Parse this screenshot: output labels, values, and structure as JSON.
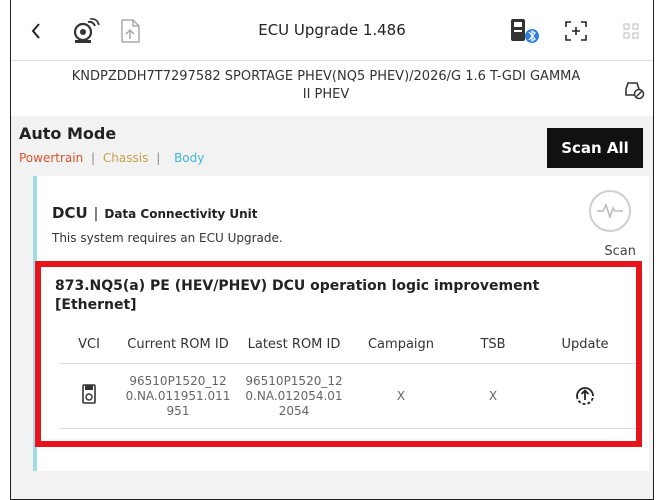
{
  "header": {
    "title": "ECU Upgrade 1.486",
    "icons": [
      "back-chevron-icon",
      "vci-connection-icon",
      "document-upload-icon",
      "bluetooth-vci-icon",
      "screen-capture-icon",
      "grid-menu-icon"
    ]
  },
  "vehicle": {
    "info": "KNDPZDDH7T7297582  SPORTAGE PHEV(NQ5 PHEV)/2026/G 1.6 T-GDI GAMMA II PHEV"
  },
  "auto_mode": {
    "title": "Auto Mode",
    "tabs": {
      "powertrain": "Powertrain",
      "sep1": "|",
      "chassis": "Chassis",
      "sep2": "|",
      "body": "Body"
    },
    "scan_all": "Scan All"
  },
  "system": {
    "code": "DCU",
    "separator": "|",
    "name": "Data Connectivity Unit",
    "message": "This system requires an ECU Upgrade.",
    "scan_label": "Scan"
  },
  "update": {
    "title": "873.NQ5(a) PE (HEV/PHEV) DCU operation logic improvement [Ethernet]",
    "columns": [
      "VCI",
      "Current ROM ID",
      "Latest ROM ID",
      "Campaign",
      "TSB",
      "Update"
    ],
    "row": {
      "current_rom": "96510P1520_12 0.NA.011951.011 951",
      "latest_rom": "96510P1520_12 0.NA.012054.01 2054",
      "campaign": "X",
      "tsb": "X"
    }
  },
  "colors": {
    "powertrain": "#d9532b",
    "chassis": "#c8a24a",
    "body": "#3fb6d6",
    "highlight_border": "#e8141b",
    "latest_rom": "#1ea8d8"
  }
}
